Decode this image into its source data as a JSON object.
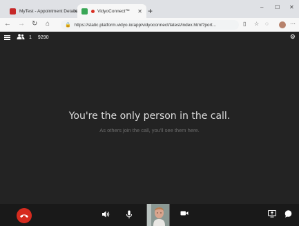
{
  "browser": {
    "tabs": [
      {
        "title": "MyTest - Appointment Details",
        "active": false,
        "favicon_color": "#c62828"
      },
      {
        "title": "VidyoConnect™",
        "active": true,
        "favicon_color": "#3aa757"
      }
    ],
    "new_tab": "+",
    "window_controls": {
      "minimize": "–",
      "maximize": "☐",
      "close": "✕"
    },
    "nav": {
      "back": "←",
      "forward": "→",
      "refresh": "↻",
      "home": "⌂"
    },
    "url": "https://static.platform.vidyo.io/app/vidyoconnect/latest/index.html?port..."
  },
  "app": {
    "participants_count": "1",
    "room_number": "9290",
    "main_message": "You're the only person in the call.",
    "sub_message": "As others join the call, you'll see them here.",
    "colors": {
      "background": "#232323",
      "bottom_bar": "#191919",
      "hangup": "#d62b1f"
    }
  },
  "icons": {
    "menu": "hamburger-icon",
    "participants": "people-icon",
    "settings": "gear-icon",
    "hangup": "phone-hangup-icon",
    "speaker": "speaker-icon",
    "microphone": "microphone-icon",
    "camera": "camera-icon",
    "share": "screen-share-icon",
    "chat": "chat-icon"
  }
}
